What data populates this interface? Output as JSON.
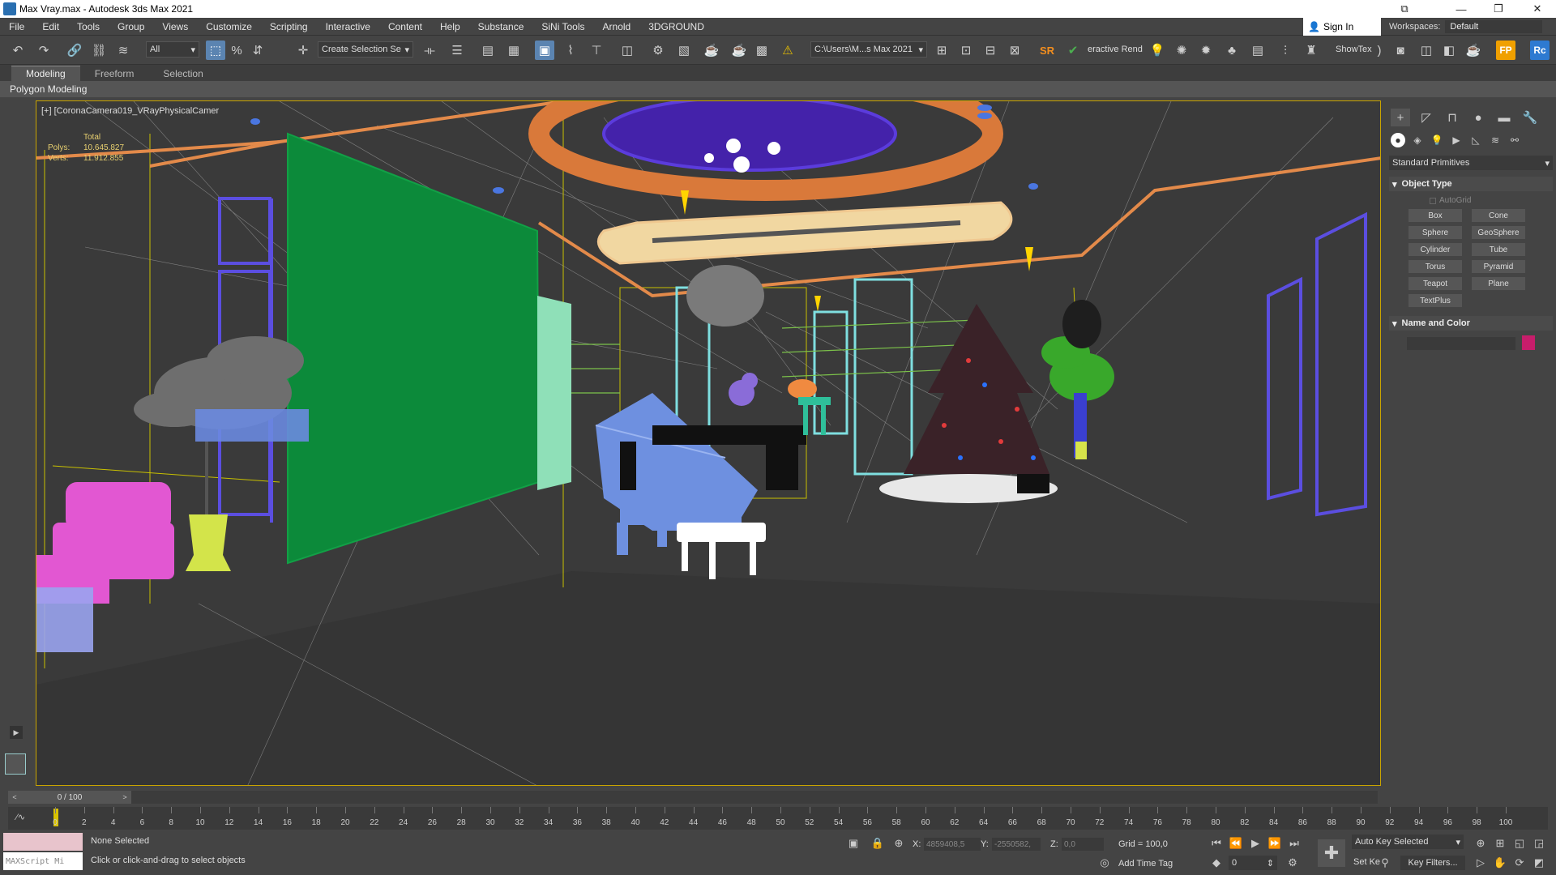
{
  "window": {
    "title": "Max Vray.max - Autodesk 3ds Max 2021"
  },
  "menu": [
    "File",
    "Edit",
    "Tools",
    "Group",
    "Views",
    "Customize",
    "Scripting",
    "Interactive",
    "Content",
    "Help",
    "Substance",
    "SiNi Tools",
    "Arnold",
    "3DGROUND"
  ],
  "signin": "Sign In",
  "workspaces": {
    "label": "Workspaces:",
    "value": "Default"
  },
  "toolbar": {
    "filter": "All",
    "selection_set": "Create Selection Se",
    "project_path": "C:\\Users\\M...s Max 2021",
    "renderer_label": "eractive Rend",
    "showtex_label": "ShowTex",
    "fp_label": "FP",
    "rc_label": "Rc",
    "sr_label": "SR"
  },
  "ribbon": {
    "tabs": [
      "Modeling",
      "Freeform",
      "Selection"
    ],
    "active": "Modeling",
    "sub": "Polygon Modeling"
  },
  "viewport": {
    "label": "[+] [CoronaCamera019_VRayPhysicalCamer",
    "stats": {
      "header": "Total",
      "polys_label": "Polys:",
      "polys": "10.645.827",
      "verts_label": "Verts:",
      "verts": "11.912.855"
    }
  },
  "command_panel": {
    "dropdown": "Standard Primitives",
    "object_type_title": "Object Type",
    "autogrid": "AutoGrid",
    "primitives": [
      "Box",
      "Cone",
      "Sphere",
      "GeoSphere",
      "Cylinder",
      "Tube",
      "Torus",
      "Pyramid",
      "Teapot",
      "Plane",
      "TextPlus"
    ],
    "name_color_title": "Name and Color",
    "object_color": "#c71d6b"
  },
  "timeline": {
    "frame": "0 / 100",
    "ticks": [
      "0",
      "2",
      "4",
      "6",
      "8",
      "10",
      "12",
      "14",
      "16",
      "18",
      "20",
      "22",
      "24",
      "26",
      "28",
      "30",
      "32",
      "34",
      "36",
      "38",
      "40",
      "42",
      "44",
      "46",
      "48",
      "50",
      "52",
      "54",
      "56",
      "58",
      "60",
      "62",
      "64",
      "66",
      "68",
      "70",
      "72",
      "74",
      "76",
      "78",
      "80",
      "82",
      "84",
      "86",
      "88",
      "90",
      "92",
      "94",
      "96",
      "98",
      "100"
    ]
  },
  "status": {
    "selection": "None Selected",
    "prompt": "Click or click-and-drag to select objects",
    "maxscript": "MAXScript Mi",
    "x_label": "X:",
    "x": "4859408,5",
    "y_label": "Y:",
    "y": "-2550582,",
    "z_label": "Z:",
    "z": "0,0",
    "grid": "Grid = 100,0",
    "add_time_tag": "Add Time Tag",
    "auto_key": "Auto Key",
    "selected": "Selected",
    "set_key": "Set Ke",
    "key_filters": "Key Filters...",
    "frame_field": "0"
  }
}
